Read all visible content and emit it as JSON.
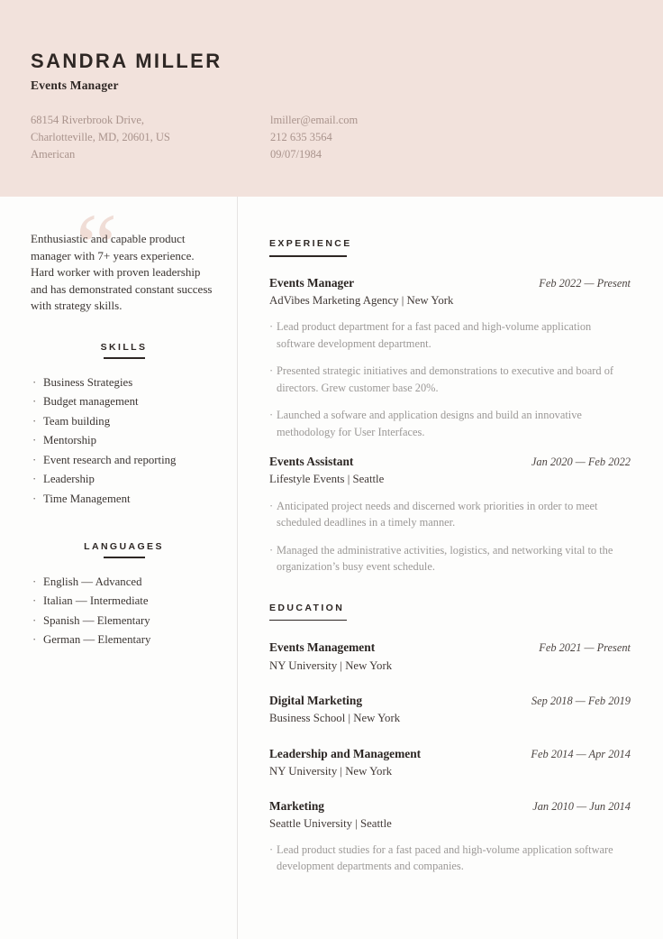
{
  "theme": {
    "header_bg": "#f2e2dc",
    "page_bg": "#fdfdfc",
    "ink": "#2e2724",
    "muted": "#9b9896",
    "contact_text": "#a9938c",
    "divider": "#e6e4e3",
    "quote_decoration": "#f0ddd6"
  },
  "header": {
    "name": "SANDRA MILLER",
    "job_title": "Events Manager",
    "contact_left": [
      "68154 Riverbrook Drive,",
      "Charlotteville, MD, 20601, US",
      "American"
    ],
    "contact_right": [
      "lmiller@email.com",
      "212 635 3564",
      "09/07/1984"
    ]
  },
  "sidebar": {
    "quote_glyph": "“",
    "summary": "Enthusiastic and capable product manager with 7+ years experience. Hard worker with proven leadership and has demonstrated constant success with strategy skills.",
    "skills": {
      "heading": "SKILLS",
      "items": [
        "Business Strategies",
        "Budget management",
        "Team building",
        "Mentorship",
        "Event research and reporting",
        "Leadership",
        "Time Management"
      ]
    },
    "languages": {
      "heading": "LANGUAGES",
      "items": [
        "English — Advanced",
        "Italian — Intermediate",
        "Spanish — Elementary",
        "German — Elementary"
      ]
    },
    "bullet_char": "·"
  },
  "experience": {
    "heading": "EXPERIENCE",
    "entries": [
      {
        "title": "Events Manager",
        "date": "Feb 2022 — Present",
        "subtitle": "AdVibes Marketing Agency | New York",
        "bullets": [
          "Lead product department for a fast paced and high-volume application software development department.",
          "Presented strategic initiatives and demonstrations to executive and board of directors. Grew customer base 20%.",
          "Launched a sofware and application designs and build an innovative methodology for User Interfaces."
        ]
      },
      {
        "title": "Events Assistant",
        "date": "Jan 2020 — Feb 2022",
        "subtitle": "Lifestyle Events | Seattle",
        "bullets": [
          "Anticipated project needs and discerned work priorities in order to meet scheduled deadlines in a timely manner.",
          "Managed the administrative activities, logistics, and networking vital to the organization’s busy event schedule."
        ]
      }
    ]
  },
  "education": {
    "heading": "EDUCATION",
    "entries": [
      {
        "title": "Events Management",
        "date": "Feb 2021 — Present",
        "subtitle": "NY University | New York",
        "bullets": []
      },
      {
        "title": "Digital Marketing",
        "date": "Sep 2018 — Feb 2019",
        "subtitle": "Business School | New York",
        "bullets": []
      },
      {
        "title": "Leadership and Management",
        "date": "Feb 2014 — Apr 2014",
        "subtitle": "NY University | New York",
        "bullets": []
      },
      {
        "title": "Marketing",
        "date": "Jan 2010 — Jun 2014",
        "subtitle": "Seattle University | Seattle",
        "bullets": [
          "Lead product studies for a fast paced and high-volume application software development departments and companies."
        ]
      }
    ]
  }
}
